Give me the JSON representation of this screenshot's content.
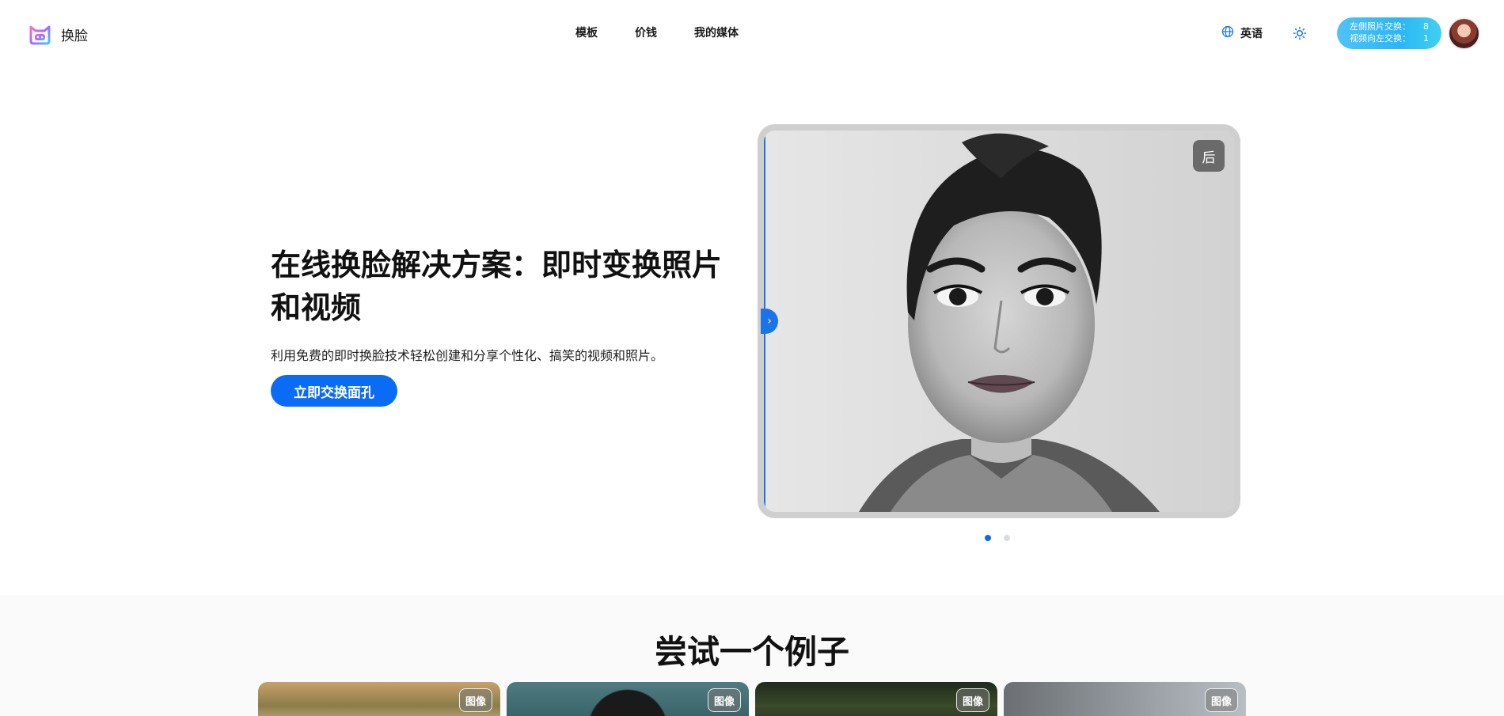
{
  "header": {
    "logo_text": "换脸",
    "nav": [
      "模板",
      "价钱",
      "我的媒体"
    ],
    "language_label": "英语",
    "credits": {
      "photo_label": "左侧照片交换：",
      "photo_value": "8",
      "video_label": "视频向左交换：",
      "video_value": "1"
    }
  },
  "hero": {
    "title": "在线换脸解决方案：即时变换照片和视频",
    "subtitle": "利用免费的即时换脸技术轻松创建和分享个性化、搞笑的视频和照片。",
    "cta_label": "立即交换面孔",
    "after_badge": "后",
    "handle_glyph": "›"
  },
  "examples": {
    "title": "尝试一个例子",
    "badge_label": "图像",
    "cards": [
      {
        "tone": "warm-forest"
      },
      {
        "tone": "teal-portrait"
      },
      {
        "tone": "dark-foliage"
      },
      {
        "tone": "grey-studio"
      }
    ]
  },
  "colors": {
    "accent": "#0a6cf5",
    "credits_gradient": "#29b6f6",
    "divider": "#1a73e8"
  }
}
